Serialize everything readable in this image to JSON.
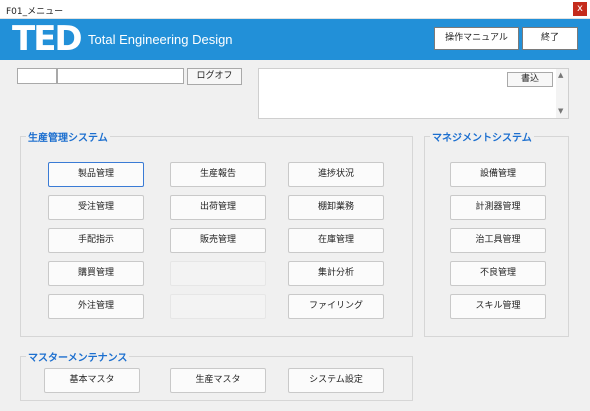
{
  "window": {
    "title": "F01_メニュー",
    "close_label": "x"
  },
  "header": {
    "logo": "TED",
    "tagline": "Total Engineering Design",
    "manual_label": "操作マニュアル",
    "exit_label": "終了"
  },
  "login": {
    "field1_value": "",
    "field2_value": "",
    "logoff_label": "ログオフ"
  },
  "memo": {
    "text": "",
    "write_label": "書込"
  },
  "production": {
    "title": "生産管理システム",
    "col1": [
      "製品管理",
      "受注管理",
      "手配指示",
      "購買管理",
      "外注管理"
    ],
    "col2": [
      "生産報告",
      "出荷管理",
      "販売管理"
    ],
    "col3": [
      "進捗状況",
      "棚卸業務",
      "在庫管理",
      "集計分析",
      "ファイリング"
    ]
  },
  "management": {
    "title": "マネジメントシステム",
    "items": [
      "設備管理",
      "計測器管理",
      "治工具管理",
      "不良管理",
      "スキル管理"
    ]
  },
  "master": {
    "title": "マスターメンテナンス",
    "items": [
      "基本マスタ",
      "生産マスタ",
      "システム設定"
    ]
  }
}
